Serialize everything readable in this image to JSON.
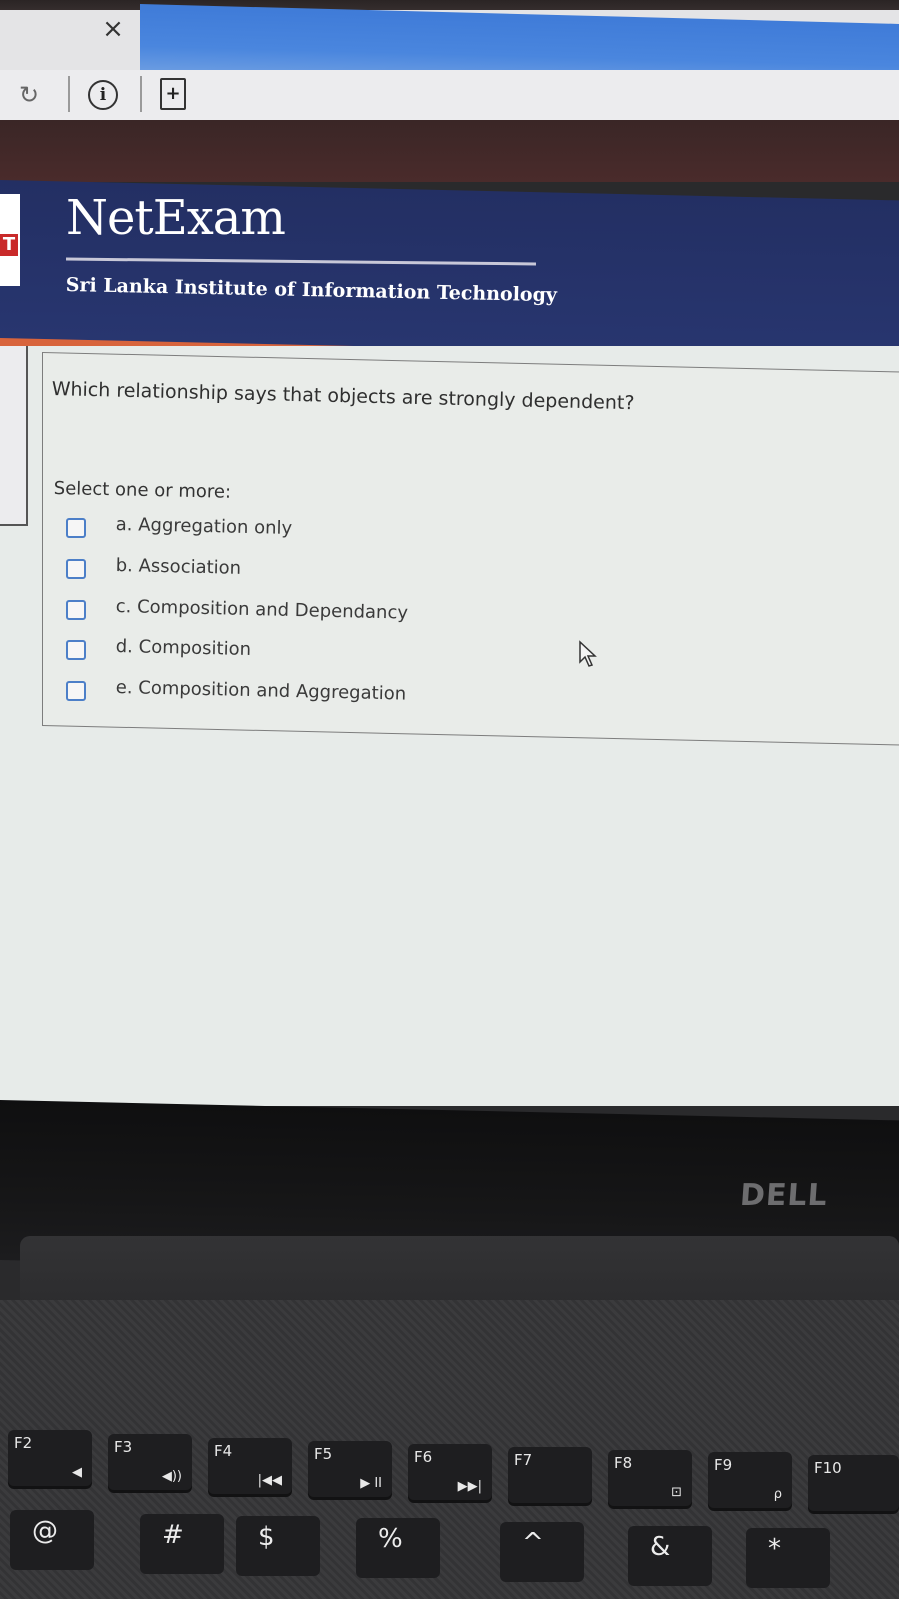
{
  "browser": {
    "tab_close_glyph": "×",
    "reload_glyph": "↻",
    "info_glyph": "i",
    "page_glyph": "+"
  },
  "site": {
    "title": "NetExam",
    "subtitle": "Sri Lanka Institute of Information Technology",
    "logo_letter": "T",
    "accent_color": "#d8643c",
    "header_color": "#232f63"
  },
  "question": {
    "text": "Which relationship says that objects are strongly dependent?",
    "instruction": "Select one or more:",
    "options": [
      {
        "label": "a. Aggregation only",
        "checked": false
      },
      {
        "label": "b. Association",
        "checked": false
      },
      {
        "label": "c. Composition and Dependancy",
        "checked": false
      },
      {
        "label": "d. Composition",
        "checked": false
      },
      {
        "label": "e. Composition and Aggregation",
        "checked": false
      }
    ]
  },
  "laptop": {
    "brand": "DELL",
    "fn_keys": [
      {
        "label": "F2",
        "icon": "◀"
      },
      {
        "label": "F3",
        "icon": "◀))"
      },
      {
        "label": "F4",
        "icon": "|◀◀"
      },
      {
        "label": "F5",
        "icon": "▶ II"
      },
      {
        "label": "F6",
        "icon": "▶▶|"
      },
      {
        "label": "F7",
        "icon": ""
      },
      {
        "label": "F8",
        "icon": "⊡"
      },
      {
        "label": "F9",
        "icon": "ρ"
      },
      {
        "label": "F10",
        "icon": ""
      }
    ],
    "num_keys": [
      "@",
      "#",
      "$",
      "%",
      "^",
      "&",
      "*"
    ]
  }
}
